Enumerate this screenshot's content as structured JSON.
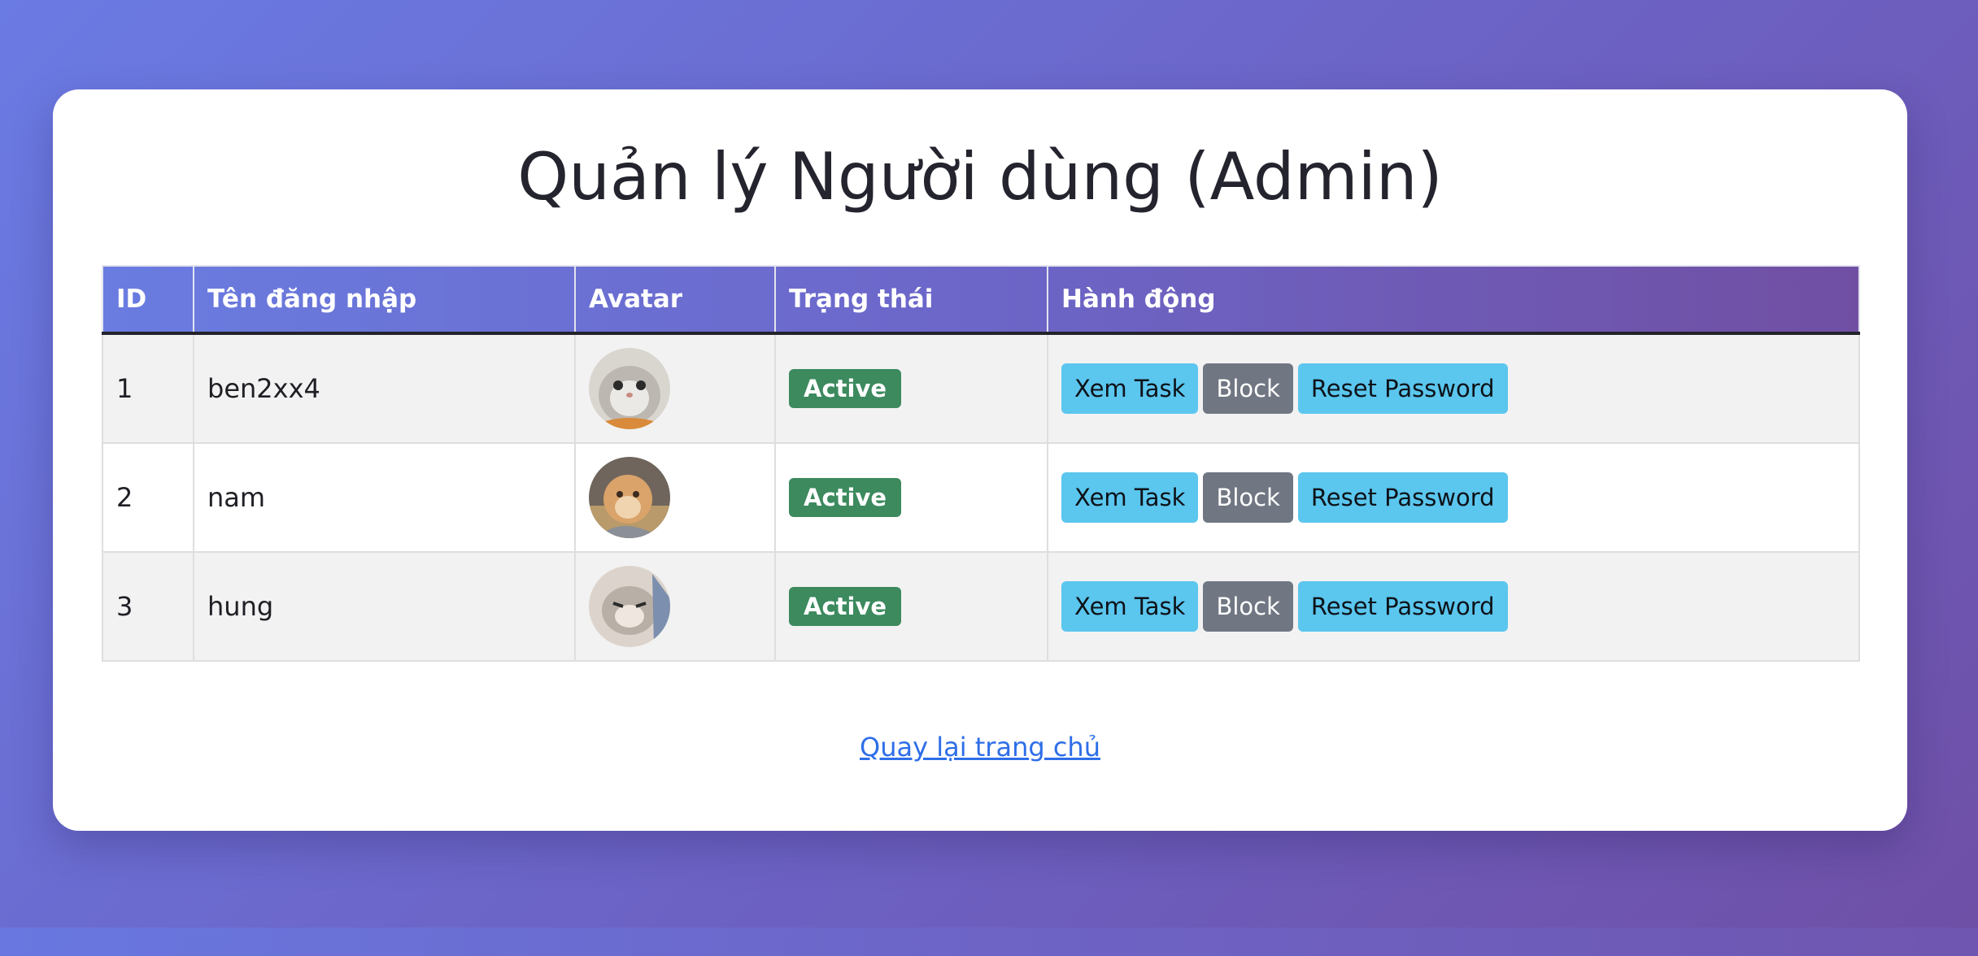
{
  "page": {
    "title": "Quản lý Người dùng (Admin)",
    "back_link": "Quay lại trang chủ"
  },
  "table": {
    "headers": {
      "id": "ID",
      "username": "Tên đăng nhập",
      "avatar": "Avatar",
      "status": "Trạng thái",
      "actions": "Hành động"
    },
    "rows": [
      {
        "id": "1",
        "username": "ben2xx4",
        "status": "Active"
      },
      {
        "id": "2",
        "username": "nam",
        "status": "Active"
      },
      {
        "id": "3",
        "username": "hung",
        "status": "Active"
      }
    ]
  },
  "actions": {
    "view_tasks": "Xem Task",
    "block": "Block",
    "reset_password": "Reset Password"
  },
  "colors": {
    "status_active": "#3c8a5e",
    "btn_info": "#5bc6ee",
    "btn_secondary": "#707682",
    "link": "#2e6ee8"
  }
}
